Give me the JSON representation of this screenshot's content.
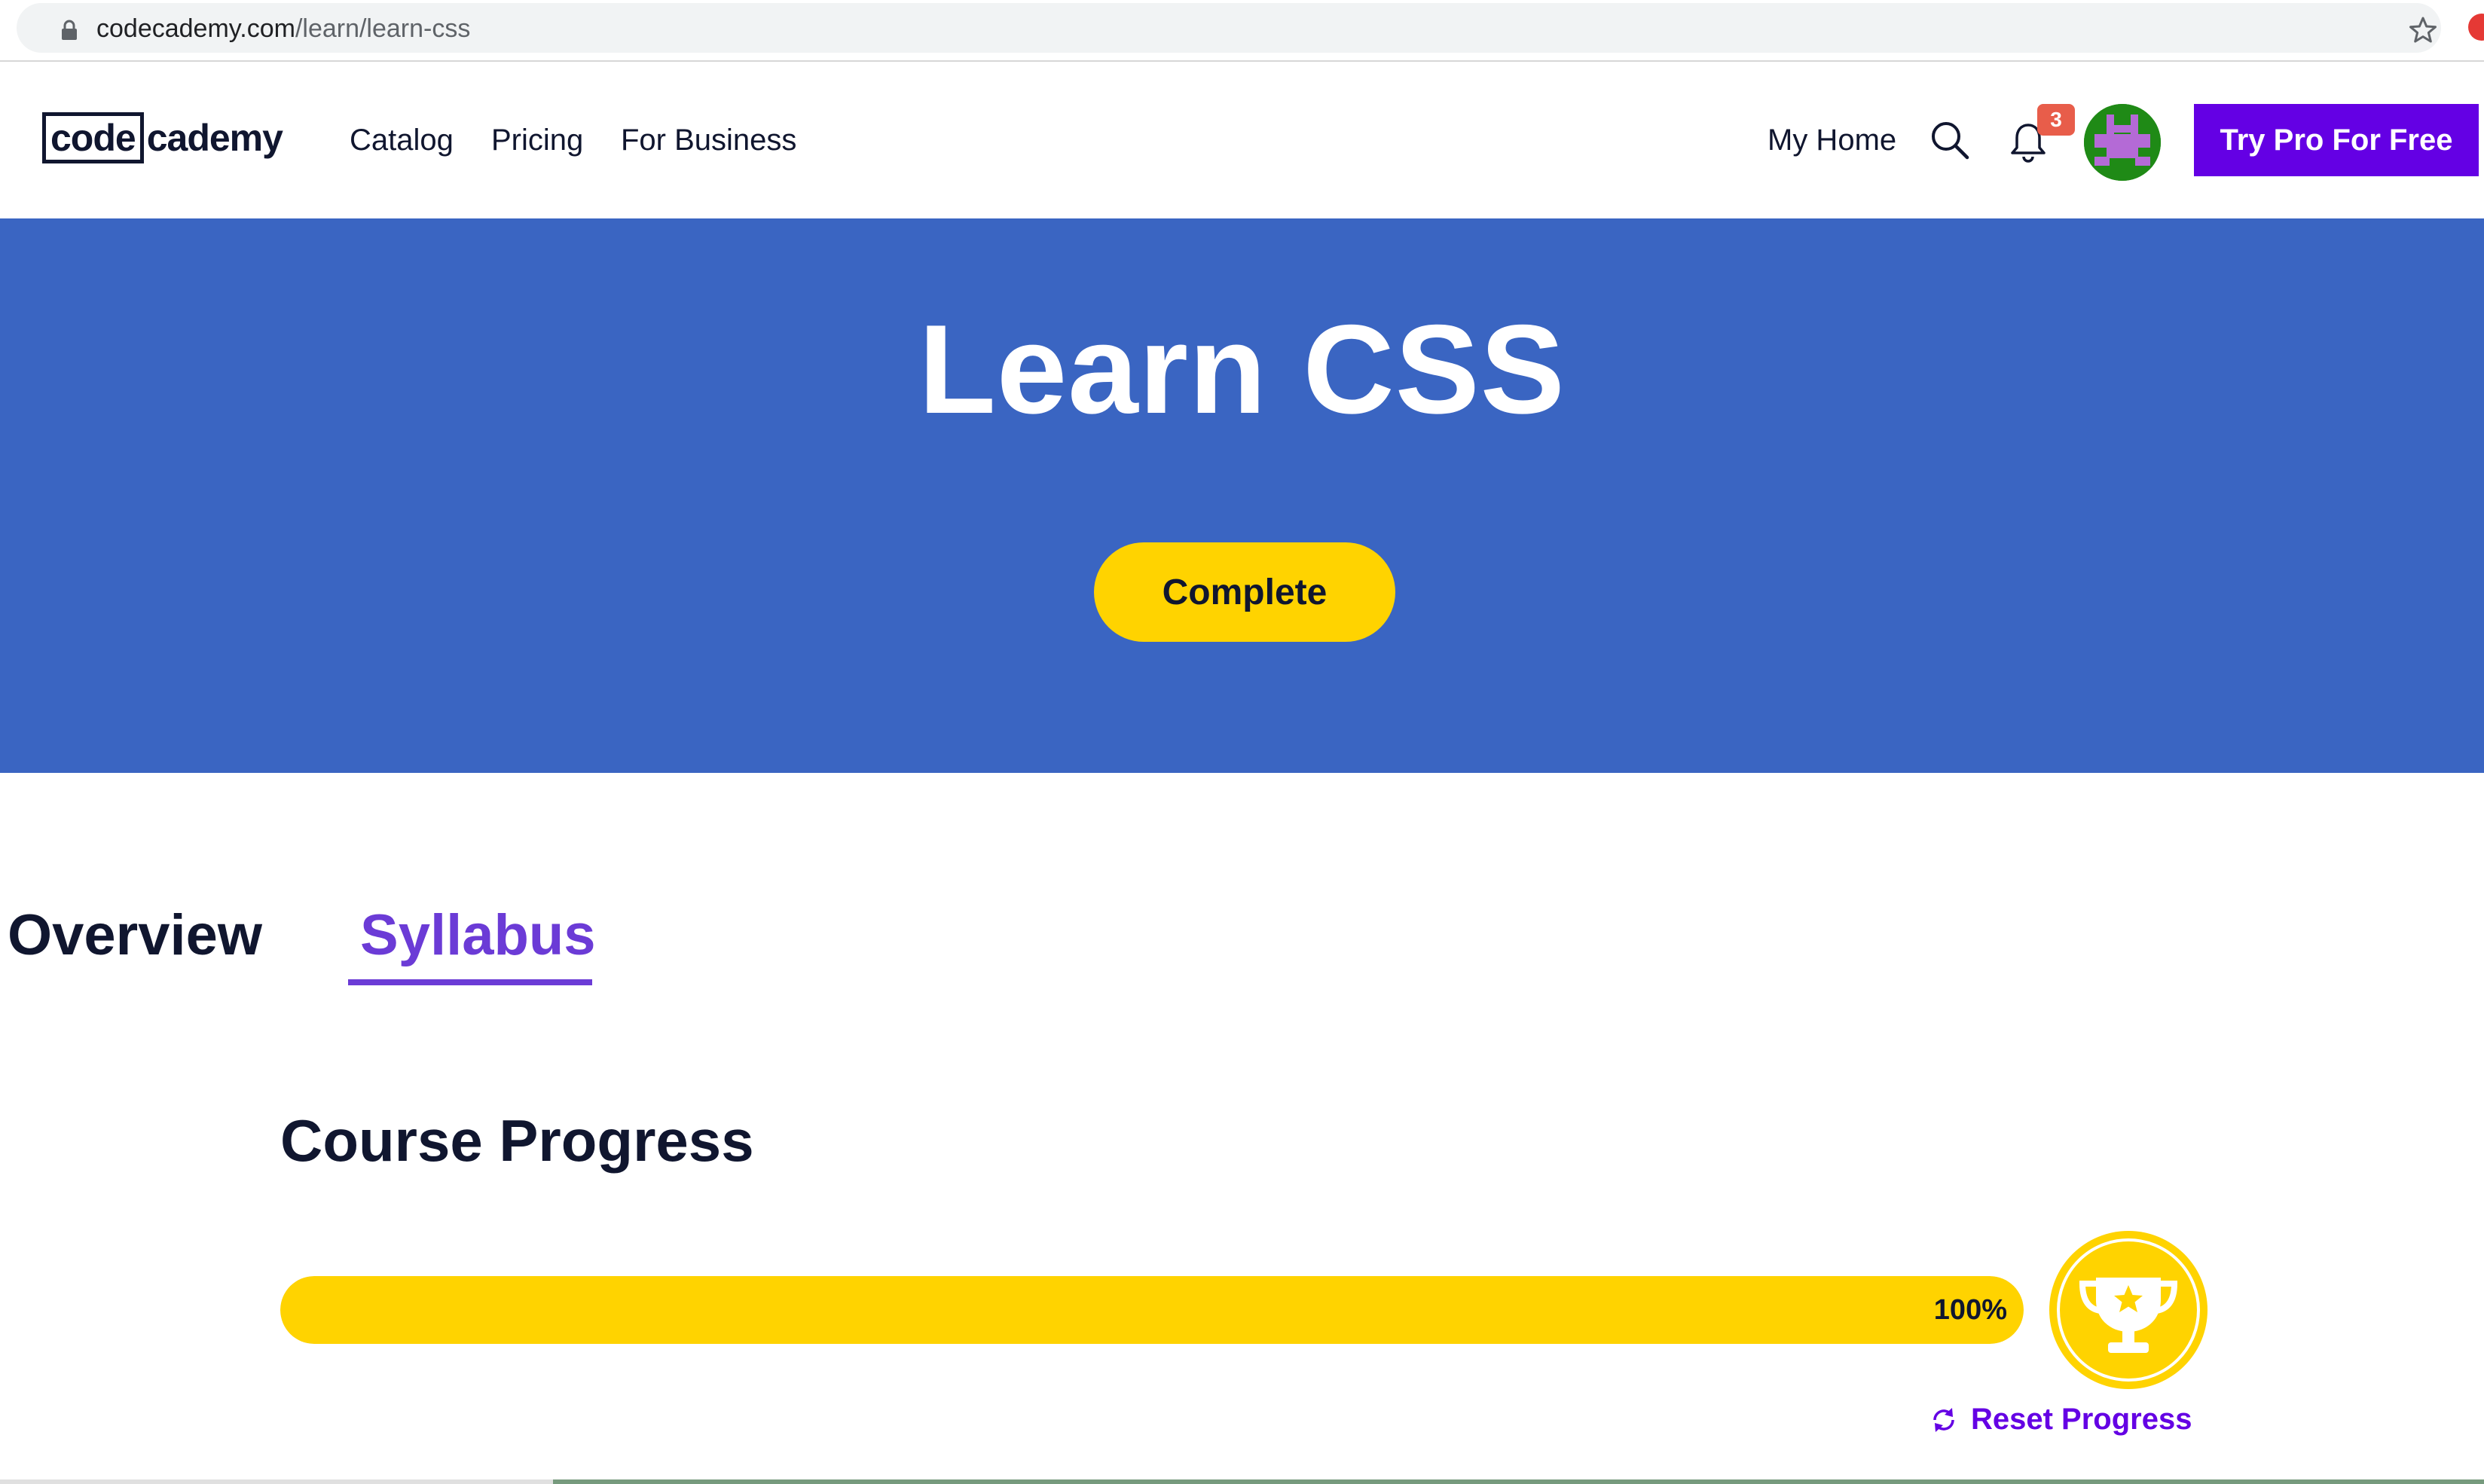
{
  "browser": {
    "url_domain": "codecademy.com",
    "url_path": "/learn/learn-css"
  },
  "header": {
    "logo_box": "code",
    "logo_rest": "cademy",
    "nav": {
      "catalog": "Catalog",
      "pricing": "Pricing",
      "for_business": "For Business",
      "my_home": "My Home"
    },
    "notification_count": "3",
    "cta": "Try Pro For Free"
  },
  "hero": {
    "title": "Learn CSS",
    "status": "Complete"
  },
  "tabs": {
    "overview": "Overview",
    "syllabus": "Syllabus",
    "active": "Syllabus"
  },
  "progress": {
    "heading": "Course Progress",
    "value_label": "100%",
    "value_fraction": 1.0,
    "reset_label": "Reset Progress"
  },
  "colors": {
    "brand_purple": "#6400e4",
    "hero_blue": "#3a65c2",
    "accent_yellow": "#ffd300"
  },
  "icons": {
    "lock": "lock-icon",
    "star": "bookmark-star-icon",
    "search": "search-icon",
    "bell": "bell-icon",
    "trophy": "trophy-icon",
    "reset": "refresh-icon"
  }
}
